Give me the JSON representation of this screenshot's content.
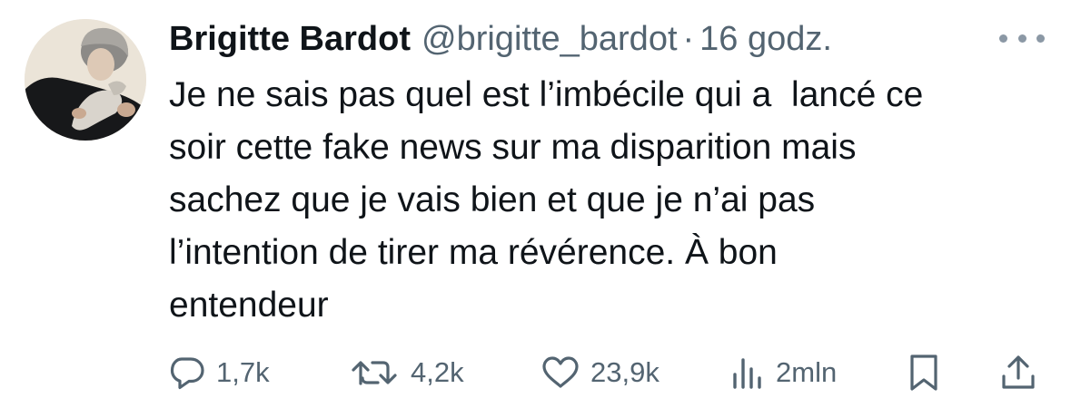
{
  "tweet": {
    "author_name": "Brigitte Bardot",
    "author_handle": "@brigitte_bardot",
    "separator": "·",
    "timestamp": "16 godz.",
    "text": "Je ne sais pas quel est l’imbécile qui a  lancé ce\nsoir cette fake news sur ma disparition mais\nsachez que je vais bien et que je n’ai pas\nl’intention de tirer ma révérence. À bon\nentendeur"
  },
  "actions": {
    "replies": "1,7k",
    "retweets": "4,2k",
    "likes": "23,9k",
    "views": "2mln"
  },
  "icons": [
    "avatar-photo",
    "more-icon",
    "reply-icon",
    "retweet-icon",
    "like-icon",
    "views-icon",
    "bookmark-icon",
    "share-icon"
  ],
  "colors": {
    "text_primary": "#0f1419",
    "text_secondary": "#536471",
    "background": "#ffffff"
  }
}
